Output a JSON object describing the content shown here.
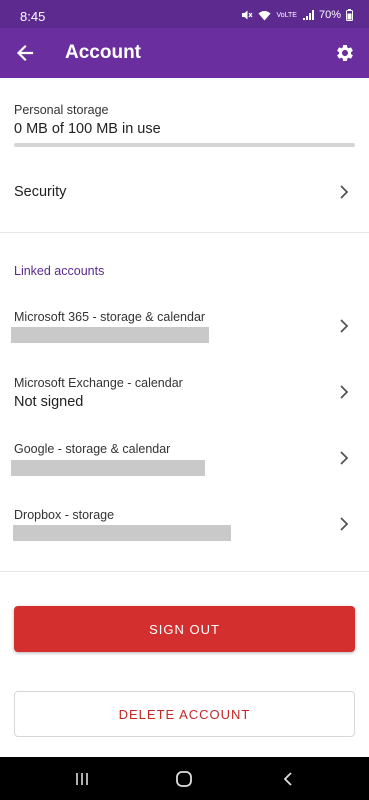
{
  "status_bar": {
    "time": "8:45",
    "battery": "70%",
    "network": "VoLTE"
  },
  "app_bar": {
    "title": "Account",
    "back_icon": "arrow-left-icon",
    "settings_icon": "gear-icon",
    "background": "#6a2e9f"
  },
  "storage": {
    "label": "Personal storage",
    "value": "0 MB of 100 MB in use",
    "used_fraction": 0.0
  },
  "security": {
    "label": "Security"
  },
  "linked_accounts": {
    "header": "Linked accounts",
    "items": [
      {
        "label": "Microsoft 365 - storage & calendar",
        "value": "",
        "redacted": true
      },
      {
        "label": "Microsoft Exchange - calendar",
        "value": "Not signed",
        "redacted": false
      },
      {
        "label": "Google - storage & calendar",
        "value": "",
        "redacted": true
      },
      {
        "label": "Dropbox - storage",
        "value": "",
        "redacted": true
      }
    ]
  },
  "buttons": {
    "sign_out": "SIGN OUT",
    "delete_account": "DELETE ACCOUNT",
    "sign_out_color": "#d32f2f"
  }
}
